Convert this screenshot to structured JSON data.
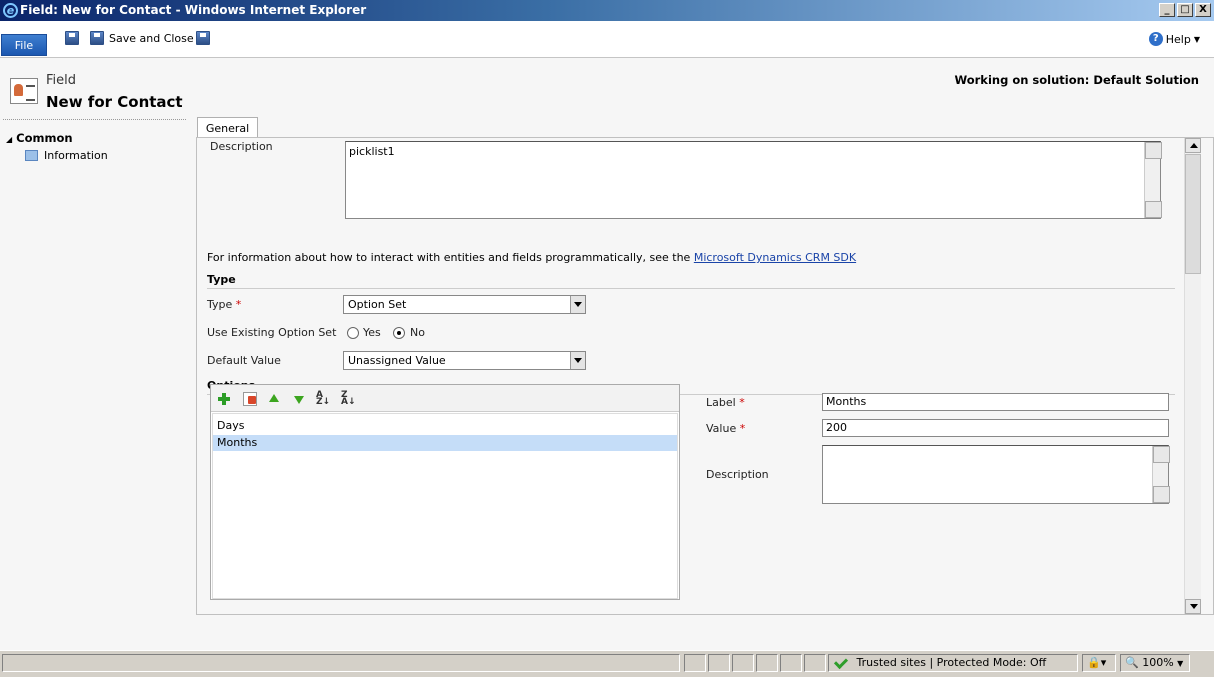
{
  "window": {
    "title": "Field: New for Contact - Windows Internet Explorer",
    "controls": [
      "_",
      "□",
      "X"
    ]
  },
  "ribbon": {
    "file_label": "File",
    "save_close_label": "Save and Close",
    "help_label": "Help"
  },
  "header": {
    "entity_type": "Field",
    "title": "New for Contact",
    "solution_text": "Working on solution: Default Solution"
  },
  "nav": {
    "group_label": "Common",
    "items": [
      {
        "label": "Information"
      }
    ]
  },
  "tabs": [
    {
      "label": "General"
    }
  ],
  "form": {
    "description_label": "Description",
    "description_value": "picklist1",
    "info_text": "For information about how to interact with entities and fields programmatically, see the ",
    "info_link": "Microsoft Dynamics CRM SDK",
    "type_section": "Type",
    "type_label": "Type",
    "type_value": "Option Set",
    "use_existing_label": "Use Existing Option Set",
    "yes_label": "Yes",
    "no_label": "No",
    "use_existing_selected": "No",
    "default_value_label": "Default Value",
    "default_value": "Unassigned Value",
    "options_section": "Options",
    "options": [
      {
        "label": "Days",
        "selected": false
      },
      {
        "label": "Months",
        "selected": true
      }
    ],
    "option_label_label": "Label",
    "option_label_value": "Months",
    "option_value_label": "Value",
    "option_value_value": "200",
    "option_description_label": "Description",
    "required_marker": "*"
  },
  "statusbar": {
    "zone_text": "Trusted sites | Protected Mode: Off",
    "zoom": "100%"
  }
}
